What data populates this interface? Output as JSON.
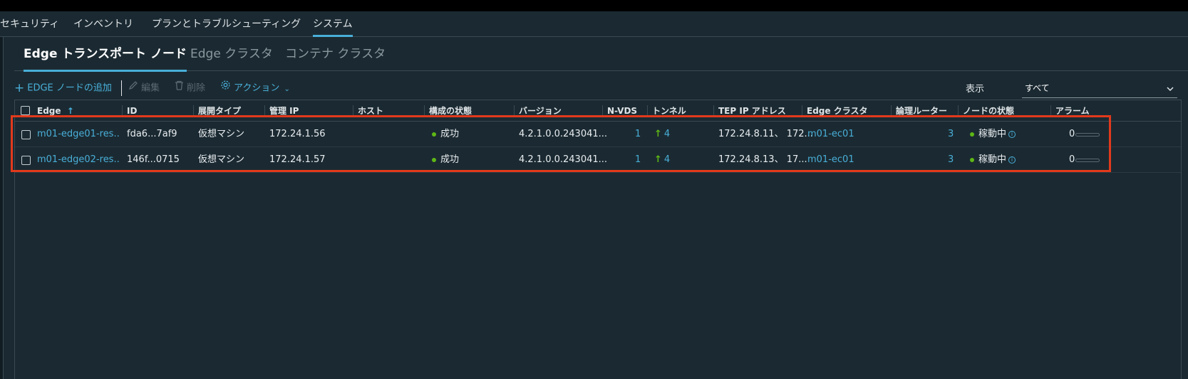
{
  "nav": {
    "items": [
      {
        "label": "セキュリティ"
      },
      {
        "label": "インベントリ"
      },
      {
        "label": "プランとトラブルシューティング"
      },
      {
        "label": "システム"
      }
    ]
  },
  "subtabs": [
    {
      "label": "Edge トランスポート ノード"
    },
    {
      "label": "Edge クラスタ"
    },
    {
      "label": "コンテナ クラスタ"
    }
  ],
  "toolbar": {
    "add_label": "EDGE ノードの追加",
    "edit_label": "編集",
    "delete_label": "削除",
    "actions_label": "アクション"
  },
  "filter": {
    "show_label": "表示",
    "selected": "すべて"
  },
  "table": {
    "columns": {
      "edge": "Edge",
      "sort_arrow": "↑",
      "id": "ID",
      "deploy_type": "展開タイプ",
      "mgmt_ip": "管理 IP",
      "host": "ホスト",
      "config_state": "構成の状態",
      "version": "バージョン",
      "nvds": "N-VDS",
      "tunnel": "トンネル",
      "tep_ip": "TEP IP アドレス",
      "edge_cluster": "Edge クラスタ",
      "logical_router": "論理ルーター",
      "node_state": "ノードの状態",
      "alarm": "アラーム"
    },
    "rows": [
      {
        "edge": "m01-edge01-res...",
        "id": "fda6...7af9",
        "deploy_type": "仮想マシン",
        "mgmt_ip": "172.24.1.56",
        "host": "",
        "config_state": "成功",
        "version": "4.2.1.0.0.243041...",
        "nvds": "1",
        "tunnel": "4",
        "tep_ip": "172.24.8.11、 172...",
        "edge_cluster": "m01-ec01",
        "logical_router": "3",
        "node_state": "稼動中",
        "alarm": "0"
      },
      {
        "edge": "m01-edge02-res...",
        "id": "146f...0715",
        "deploy_type": "仮想マシン",
        "mgmt_ip": "172.24.1.57",
        "host": "",
        "config_state": "成功",
        "version": "4.2.1.0.0.243041...",
        "nvds": "1",
        "tunnel": "4",
        "tep_ip": "172.24.8.13、 17...",
        "edge_cluster": "m01-ec01",
        "logical_router": "3",
        "node_state": "稼動中",
        "alarm": "0"
      }
    ]
  },
  "colors": {
    "accent": "#49afd9",
    "success": "#5eb715",
    "highlight": "#e2391c"
  }
}
